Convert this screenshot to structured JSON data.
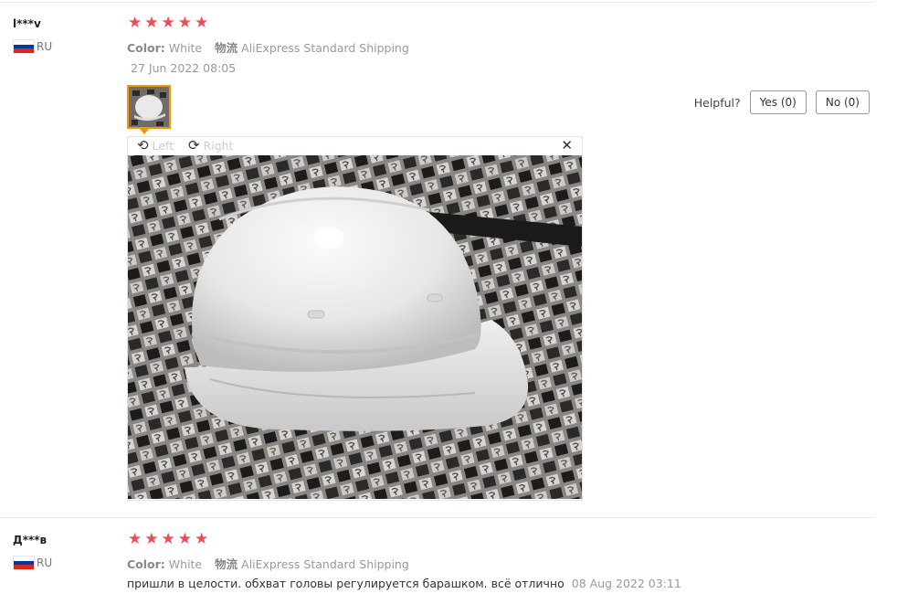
{
  "reviews": [
    {
      "user": "l***v",
      "country": "RU",
      "rating": 5,
      "color_label": "Color:",
      "color_value": "White",
      "shipping_label": "物流",
      "shipping_value": "AliExpress Standard Shipping",
      "date": "27 Jun 2022 08:05"
    },
    {
      "user": "Д***в",
      "country": "RU",
      "rating": 5,
      "color_label": "Color:",
      "color_value": "White",
      "shipping_label": "物流",
      "shipping_value": "AliExpress Standard Shipping",
      "text": "пришли в целости. обхват головы регулируется барашком. всё отлично",
      "date": "08 Aug 2022 03:11"
    }
  ],
  "helpful": {
    "label": "Helpful?",
    "yes": "Yes (0)",
    "no": "No (0)"
  },
  "viewer": {
    "rotate_left": "Left",
    "rotate_right": "Right",
    "close_icon": "close-icon",
    "rotate_left_icon": "rotate-left-icon",
    "rotate_right_icon": "rotate-right-icon"
  },
  "colors": {
    "star": "#ef4c54",
    "thumb_border": "#f39800"
  }
}
